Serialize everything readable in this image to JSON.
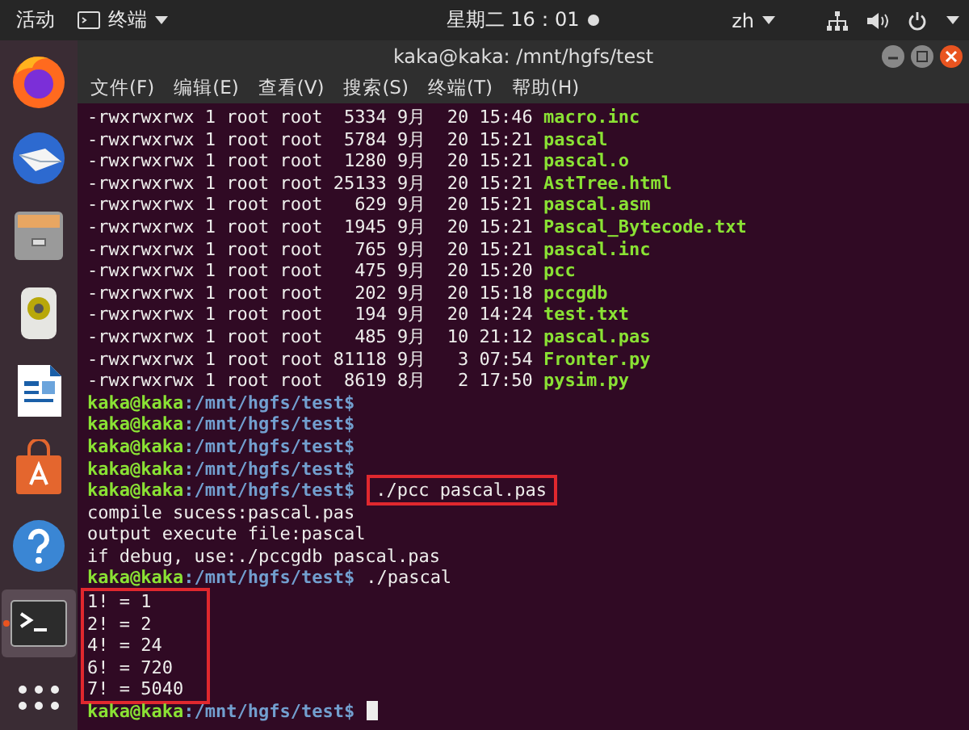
{
  "top_bar": {
    "activities": "活动",
    "app_menu": "终端",
    "clock": "星期二 16：01",
    "notification": true,
    "input_method": "zh"
  },
  "dock": {
    "items": [
      {
        "kind": "firefox",
        "selected": false
      },
      {
        "kind": "mail",
        "selected": false
      },
      {
        "kind": "files",
        "selected": false
      },
      {
        "kind": "music",
        "selected": false
      },
      {
        "kind": "writer",
        "selected": false
      },
      {
        "kind": "store",
        "selected": false
      },
      {
        "kind": "help",
        "selected": false
      },
      {
        "kind": "terminal",
        "selected": true
      },
      {
        "kind": "apps",
        "selected": false
      }
    ]
  },
  "window": {
    "title": "kaka@kaka: /mnt/hgfs/test",
    "menu": [
      "文件(F)",
      "编辑(E)",
      "查看(V)",
      "搜索(S)",
      "终端(T)",
      "帮助(H)"
    ]
  },
  "terminal": {
    "lines": [
      {
        "kind": "listing",
        "details": "-rwxrwxrwx 1 root root  5334 9月  20 15:46",
        "name": "macro.inc"
      },
      {
        "kind": "listing",
        "details": "-rwxrwxrwx 1 root root  5784 9月  20 15:21",
        "name": "pascal"
      },
      {
        "kind": "listing",
        "details": "-rwxrwxrwx 1 root root  1280 9月  20 15:21",
        "name": "pascal.o"
      },
      {
        "kind": "listing",
        "details": "-rwxrwxrwx 1 root root 25133 9月  20 15:21",
        "name": "AstTree.html"
      },
      {
        "kind": "listing",
        "details": "-rwxrwxrwx 1 root root   629 9月  20 15:21",
        "name": "pascal.asm"
      },
      {
        "kind": "listing",
        "details": "-rwxrwxrwx 1 root root  1945 9月  20 15:21",
        "name": "Pascal_Bytecode.txt"
      },
      {
        "kind": "listing",
        "details": "-rwxrwxrwx 1 root root   765 9月  20 15:21",
        "name": "pascal.inc"
      },
      {
        "kind": "listing",
        "details": "-rwxrwxrwx 1 root root   475 9月  20 15:20",
        "name": "pcc"
      },
      {
        "kind": "listing",
        "details": "-rwxrwxrwx 1 root root   202 9月  20 15:18",
        "name": "pccgdb"
      },
      {
        "kind": "listing",
        "details": "-rwxrwxrwx 1 root root   194 9月  20 14:24",
        "name": "test.txt"
      },
      {
        "kind": "listing",
        "details": "-rwxrwxrwx 1 root root   485 9月  10 21:12",
        "name": "pascal.pas"
      },
      {
        "kind": "listing",
        "details": "-rwxrwxrwx 1 root root 81118 9月   3 07:54",
        "name": "Fronter.py"
      },
      {
        "kind": "listing",
        "details": "-rwxrwxrwx 1 root root  8619 8月   2 17:50",
        "name": "pysim.py"
      },
      {
        "kind": "prompt",
        "user": "kaka@kaka",
        "path": ":/mnt/hgfs/test$"
      },
      {
        "kind": "prompt",
        "user": "kaka@kaka",
        "path": ":/mnt/hgfs/test$"
      },
      {
        "kind": "prompt",
        "user": "kaka@kaka",
        "path": ":/mnt/hgfs/test$"
      },
      {
        "kind": "prompt",
        "user": "kaka@kaka",
        "path": ":/mnt/hgfs/test$"
      },
      {
        "kind": "prompt",
        "user": "kaka@kaka",
        "path": ":/mnt/hgfs/test$",
        "command": "./pcc pascal.pas",
        "highlighted": true
      },
      {
        "kind": "output",
        "text": "compile sucess:pascal.pas"
      },
      {
        "kind": "output",
        "text": "output execute file:pascal"
      },
      {
        "kind": "output",
        "text": "if debug, use:./pccgdb pascal.pas"
      },
      {
        "kind": "prompt",
        "user": "kaka@kaka",
        "path": ":/mnt/hgfs/test$",
        "command": "./pascal",
        "highlighted": false
      },
      {
        "kind": "group",
        "highlighted": true,
        "lines": [
          "1! = 1",
          "2! = 2",
          "4! = 24",
          "6! = 720",
          "7! = 5040"
        ]
      },
      {
        "kind": "active_prompt",
        "user": "kaka@kaka",
        "path": ":/mnt/hgfs/test$"
      }
    ]
  }
}
